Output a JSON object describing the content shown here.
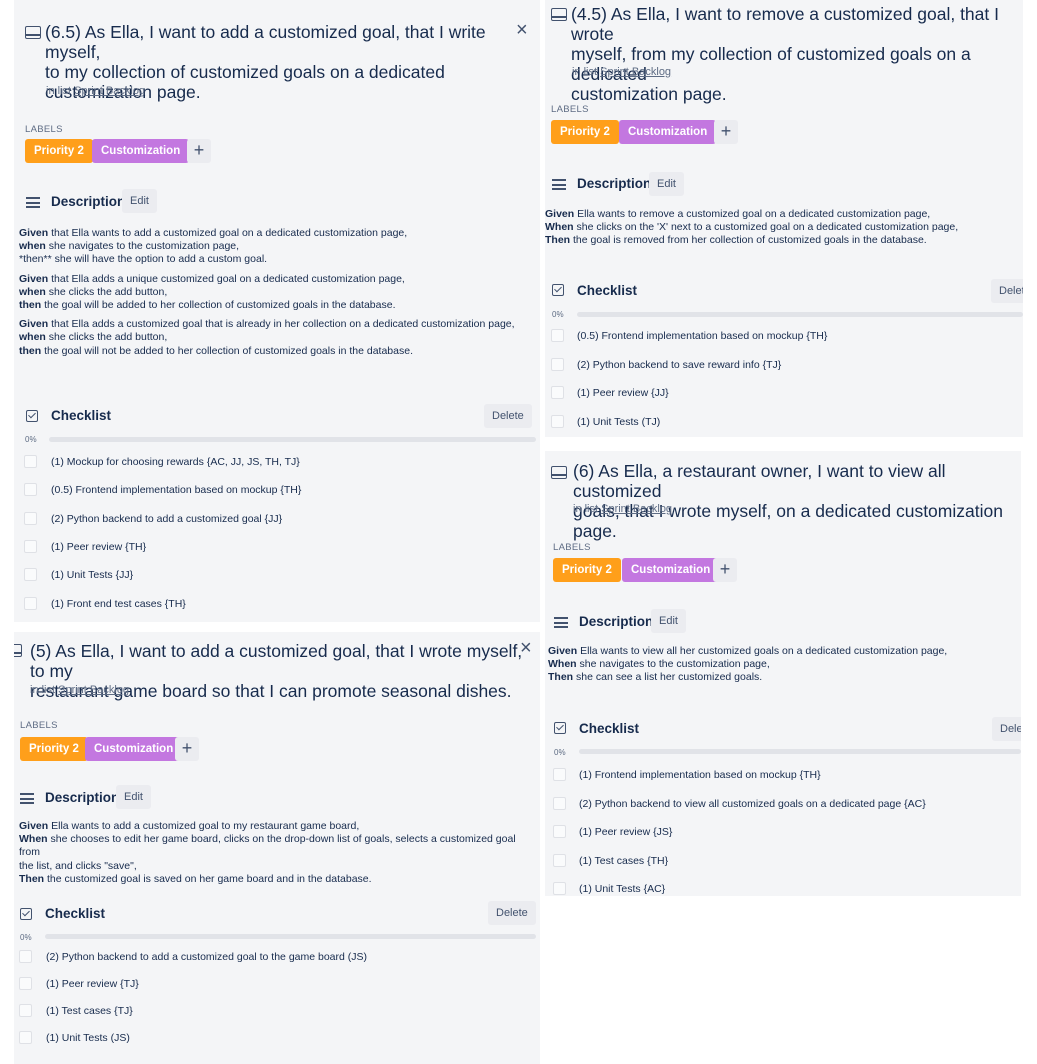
{
  "common": {
    "in_list_prefix": "in list",
    "list_name": "Sprint Backlog",
    "labels_heading": "LABELS",
    "label_priority": "Priority 2",
    "label_customization": "Customization",
    "add_label": "+",
    "description_heading": "Description",
    "edit_button": "Edit",
    "checklist_heading": "Checklist",
    "delete_button": "Delete",
    "close_icon": "×",
    "progress_percent": "0%",
    "progress_value": 0
  },
  "colors": {
    "priority": "#ff9f1a",
    "customization": "#c377e0",
    "background": "#f4f5f7"
  },
  "card1": {
    "title_line1": "(6.5) As Ella, I want to add a customized goal, that I write myself,",
    "title_line2": "to my collection of customized goals on a dedicated",
    "title_line3": "customization page.",
    "desc": [
      {
        "k1": "Given",
        "t1": " that Ella wants to add a customized goal on a dedicated customization page,",
        "k2": "when",
        "t2": " she navigates to the customization page,",
        "l3": "*then** she will have the option to add a custom goal."
      },
      {
        "k1": "Given",
        "t1": " that Ella adds a unique customized goal on a dedicated customization page,",
        "k2": "when",
        "t2": " she clicks the add button,",
        "k3": "then",
        "t3": " the goal will be added to her collection of customized goals in the database."
      },
      {
        "k1": "Given",
        "t1": " that Ella adds a customized goal that is already in her collection on a dedicated customization page,",
        "k2": "when",
        "t2": " she clicks the add button,",
        "k3": "then",
        "t3": " the goal will not be added to her collection of customized goals in the database."
      }
    ],
    "checklist": [
      "(1) Mockup for choosing rewards {AC, JJ, JS, TH, TJ}",
      "(0.5) Frontend implementation based on mockup {TH}",
      "(2) Python backend to add a customized goal {JJ}",
      "(1) Peer review {TH}",
      "(1) Unit Tests {JJ}",
      "(1) Front end test cases {TH}"
    ]
  },
  "card2": {
    "title_line1": "(5) As Ella, I want to add a customized goal, that I wrote myself, to my",
    "title_line2": "restaurant game board so that I can promote seasonal dishes.",
    "desc": {
      "k1": "Given",
      "t1": " Ella wants to add a customized goal to my restaurant game board,",
      "k2": "When",
      "t2": " she chooses to edit her game board, clicks on the drop-down list of goals, selects a customized goal from",
      "l2b": "the list, and clicks \"save\",",
      "k3": "Then",
      "t3": " the customized goal is saved on her game board and in the database."
    },
    "checklist": [
      "(2) Python backend to add a customized goal to the game board (JS)",
      "(1) Peer review {TJ}",
      "(1) Test cases {TJ}",
      "(1) Unit Tests (JS)"
    ]
  },
  "card3": {
    "title_line1": "(4.5) As Ella, I want to remove a customized goal, that I wrote",
    "title_line2": "myself, from my collection of customized goals on a dedicated",
    "title_line3": "customization page.",
    "desc": {
      "k1": "Given",
      "t1": " Ella wants to remove a customized goal on a dedicated customization page,",
      "k2": "When",
      "t2": " she clicks on the 'X' next to a customized goal on a dedicated customization page,",
      "k3": "Then",
      "t3": " the goal is removed from her collection of customized goals in the database."
    },
    "delete_partial": "Delet",
    "checklist": [
      "(0.5) Frontend implementation based on mockup {TH}",
      "(2) Python backend to save reward info {TJ}",
      "(1) Peer review {JJ}",
      "(1) Unit Tests (TJ)"
    ]
  },
  "card4": {
    "title_line1": "(6) As Ella, a restaurant owner, I want to view all customized",
    "title_line2": "goals, that I wrote myself, on a dedicated customization page.",
    "desc": {
      "k1": "Given",
      "t1": " Ella wants to view all her customized goals on a dedicated customization page,",
      "k2": "When",
      "t2": " she navigates to the customization page,",
      "k3": "Then",
      "t3": " she can see a list her customized goals."
    },
    "delete_partial": "Dele",
    "checklist": [
      "(1) Frontend implementation based on mockup {TH}",
      "(2) Python backend to view all customized goals on a dedicated page {AC}",
      "(1) Peer review {JS}",
      "(1) Test cases {TH}",
      "(1) Unit Tests {AC}"
    ]
  }
}
